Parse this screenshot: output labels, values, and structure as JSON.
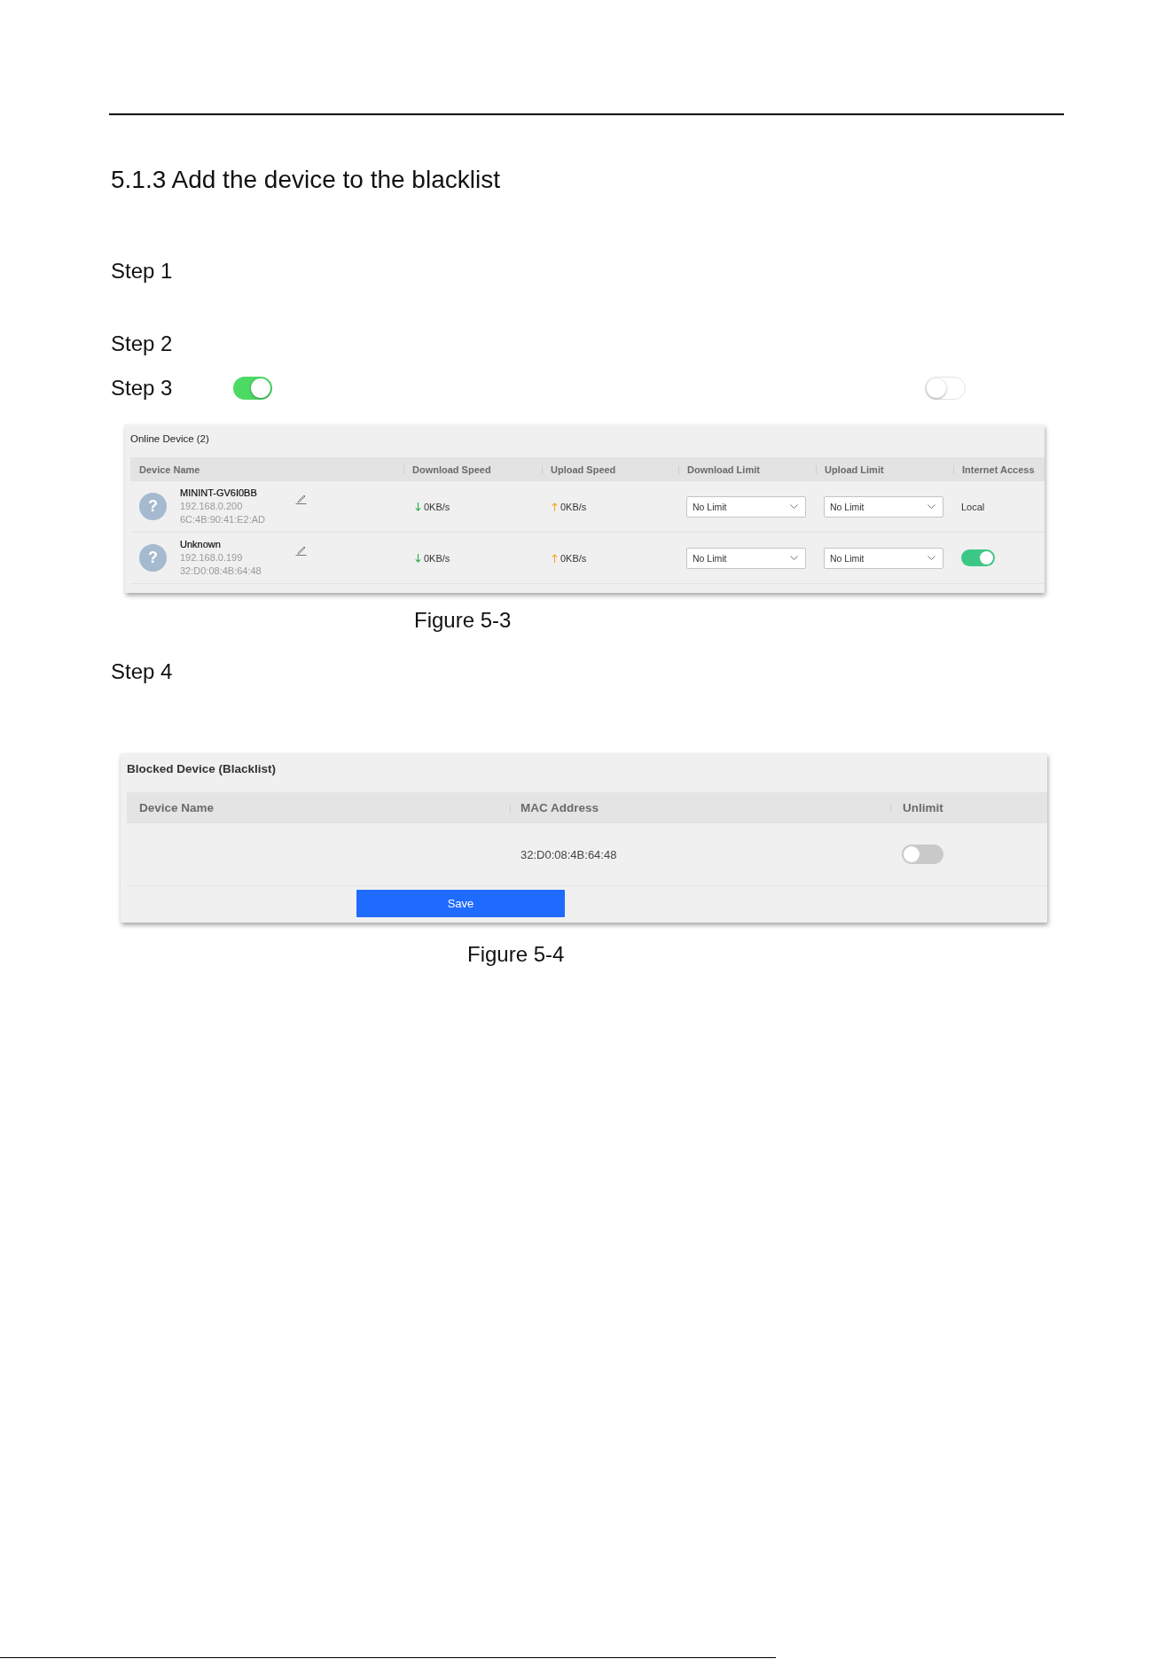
{
  "heading": "5.1.3 Add the device to the blacklist",
  "blocks": [
    {
      "kind": "step",
      "label": "Step 1"
    },
    {
      "kind": "step",
      "label": "Step 2"
    },
    {
      "kind": "step",
      "label": "Step 3",
      "switches": [
        {
          "on": true
        },
        {
          "on": false
        }
      ]
    },
    {
      "kind": "online_devices",
      "title": "Online Device (2)",
      "columns": [
        "Device Name",
        "Download Speed",
        "Upload Speed",
        "Download Limit",
        "Upload Limit",
        "Internet Access"
      ],
      "rows": [
        {
          "avatar": "?",
          "name": "MININT-GV6I0BB",
          "ip": "192.168.0.200",
          "mac": "6C:4B:90:41:E2:AD",
          "download_speed": "0KB/s",
          "upload_speed": "0KB/s",
          "download_limit": "No Limit",
          "upload_limit": "No Limit",
          "internet_access": {
            "kind": "text",
            "text": "Local"
          }
        },
        {
          "avatar": "?",
          "name": "Unknown",
          "ip": "192.168.0.199",
          "mac": "32:D0:08:4B:64:48",
          "download_speed": "0KB/s",
          "upload_speed": "0KB/s",
          "download_limit": "No Limit",
          "upload_limit": "No Limit",
          "internet_access": {
            "kind": "switch",
            "on": true
          }
        }
      ],
      "caption": "Figure 5-3"
    },
    {
      "kind": "step",
      "label": "Step 4"
    },
    {
      "kind": "blocked_devices",
      "title": "Blocked Device (Blacklist)",
      "columns": [
        "Device Name",
        "MAC Address",
        "Unlimit"
      ],
      "rows": [
        {
          "mac": "32:D0:08:4B:64:48",
          "unlimit": false
        }
      ],
      "save_button": "Save",
      "caption": "Figure 5-4"
    }
  ]
}
